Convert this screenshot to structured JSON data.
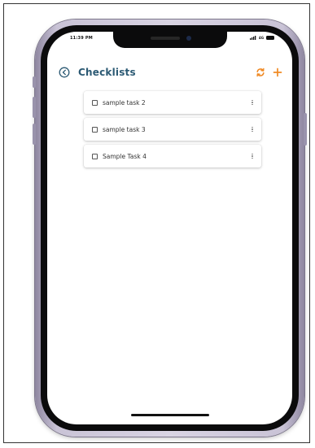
{
  "status_bar": {
    "time": "11:39 PM",
    "network": "4G"
  },
  "header": {
    "title": "Checklists",
    "back_icon": "back-circle-icon",
    "sync_icon": "sync-icon",
    "add_icon": "plus-icon"
  },
  "tasks": [
    {
      "label": "sample task 2"
    },
    {
      "label": "sample task 3"
    },
    {
      "label": "Sample Task 4"
    }
  ],
  "colors": {
    "title": "#2c5a74",
    "accent": "#f08a24",
    "back_icon": "#2c5a74"
  }
}
